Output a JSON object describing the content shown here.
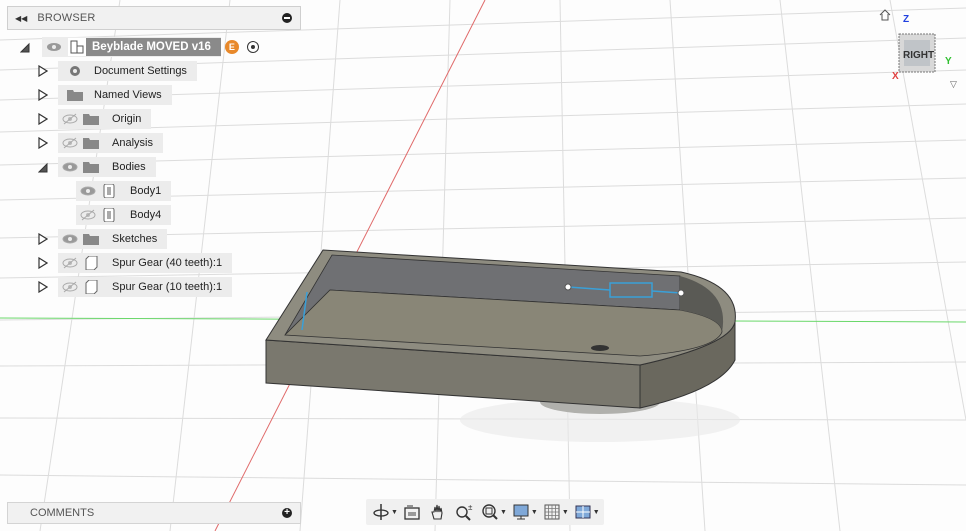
{
  "browser": {
    "title": "BROWSER",
    "root": {
      "label": "Beyblade MOVED v16",
      "badge": "E"
    },
    "items": [
      {
        "label": "Document Settings",
        "icon": "gear-icon",
        "expanded": false,
        "visible_toggle": false
      },
      {
        "label": "Named Views",
        "icon": "folder-icon",
        "expanded": false,
        "visible_toggle": false
      },
      {
        "label": "Origin",
        "icon": "folder-icon",
        "expanded": false,
        "visibility": "hidden"
      },
      {
        "label": "Analysis",
        "icon": "folder-icon",
        "expanded": false,
        "visibility": "hidden"
      },
      {
        "label": "Bodies",
        "icon": "folder-icon",
        "expanded": true,
        "visibility": "visible"
      },
      {
        "label": "Body1",
        "icon": "body-icon",
        "visibility": "visible"
      },
      {
        "label": "Body4",
        "icon": "body-icon",
        "visibility": "hidden"
      },
      {
        "label": "Sketches",
        "icon": "folder-icon",
        "expanded": false,
        "visibility": "visible"
      },
      {
        "label": "Spur Gear (40 teeth):1",
        "icon": "component-icon",
        "expanded": false,
        "visibility": "hidden"
      },
      {
        "label": "Spur Gear (10 teeth):1",
        "icon": "component-icon",
        "expanded": false,
        "visibility": "hidden"
      }
    ]
  },
  "comments": {
    "title": "COMMENTS"
  },
  "viewcube": {
    "face": "RIGHT",
    "axis_z": "Z",
    "axis_y": "Y",
    "axis_x": "X"
  },
  "colors": {
    "accent_orange": "#e8892b",
    "x_axis": "#e04040",
    "y_axis": "#40d040",
    "z_axis": "#2040e0",
    "sketch": "#3aa0d8"
  }
}
